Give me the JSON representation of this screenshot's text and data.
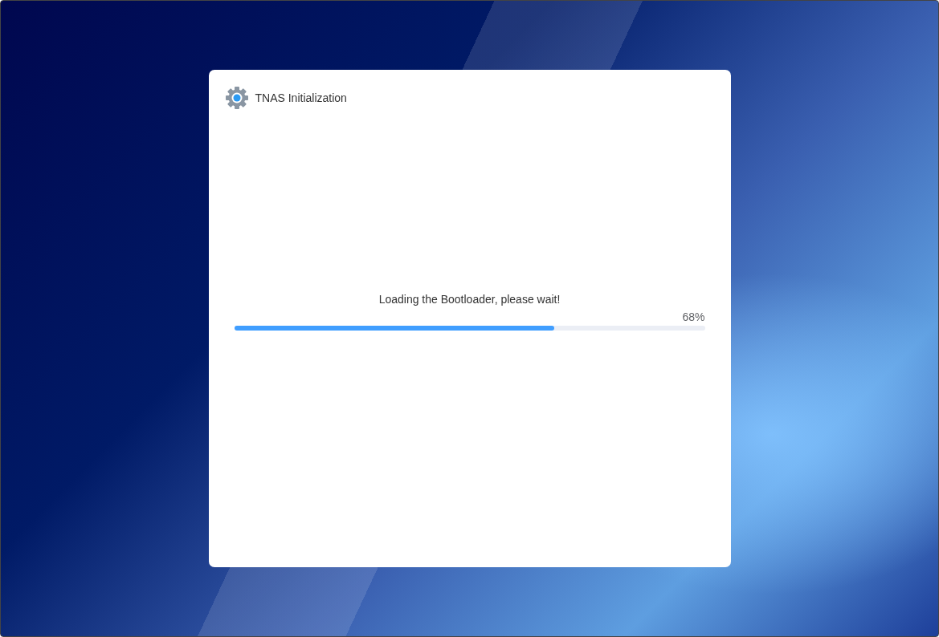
{
  "dialog": {
    "title": "TNAS Initialization"
  },
  "progress": {
    "message": "Loading the Bootloader, please wait!",
    "percent_label": "68%",
    "level": 0.68
  }
}
